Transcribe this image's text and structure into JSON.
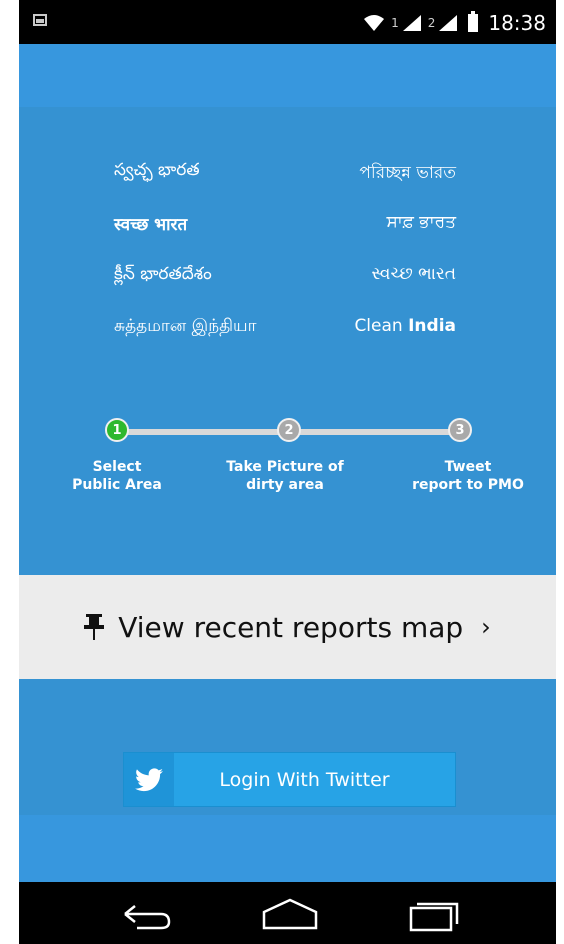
{
  "status_bar": {
    "sim1_label": "1",
    "sim2_label": "2",
    "time": "18:38",
    "icons": [
      "picture-icon",
      "wifi-icon",
      "signal-icon",
      "battery-icon"
    ]
  },
  "languages": [
    {
      "left": "స్వచ్ఛ భారత",
      "right": "পরিচ্ছন্ন ভারত"
    },
    {
      "left": "स्वच्छ भारत",
      "right": "ਸਾਫ਼ ਭਾਰਤ"
    },
    {
      "left": "క్లీన్ భారతదేశం",
      "right": "સ્વચ્છ ભારત"
    },
    {
      "left": "சுத்தமான இந்தியா",
      "right_prefix": "Clean ",
      "right_bold": "India"
    }
  ],
  "steps": [
    {
      "num": "1",
      "line1": "Select",
      "line2": "Public Area",
      "status": "active"
    },
    {
      "num": "2",
      "line1": "Take Picture of",
      "line2": "dirty area",
      "status": "inactive"
    },
    {
      "num": "3",
      "line1": "Tweet",
      "line2": "report to PMO",
      "status": "inactive"
    }
  ],
  "reports_map": {
    "label": "View recent reports map",
    "chevron": "›",
    "icon": "pushpin-icon"
  },
  "login": {
    "label": "Login With Twitter",
    "icon": "twitter-bird-icon"
  },
  "colors": {
    "background_blue": "#3592D2",
    "band_blue": "#3797DE",
    "active_step": "#2eb82e",
    "inactive_step": "#a9a9a9",
    "twitter_button": "#27A3E6"
  }
}
